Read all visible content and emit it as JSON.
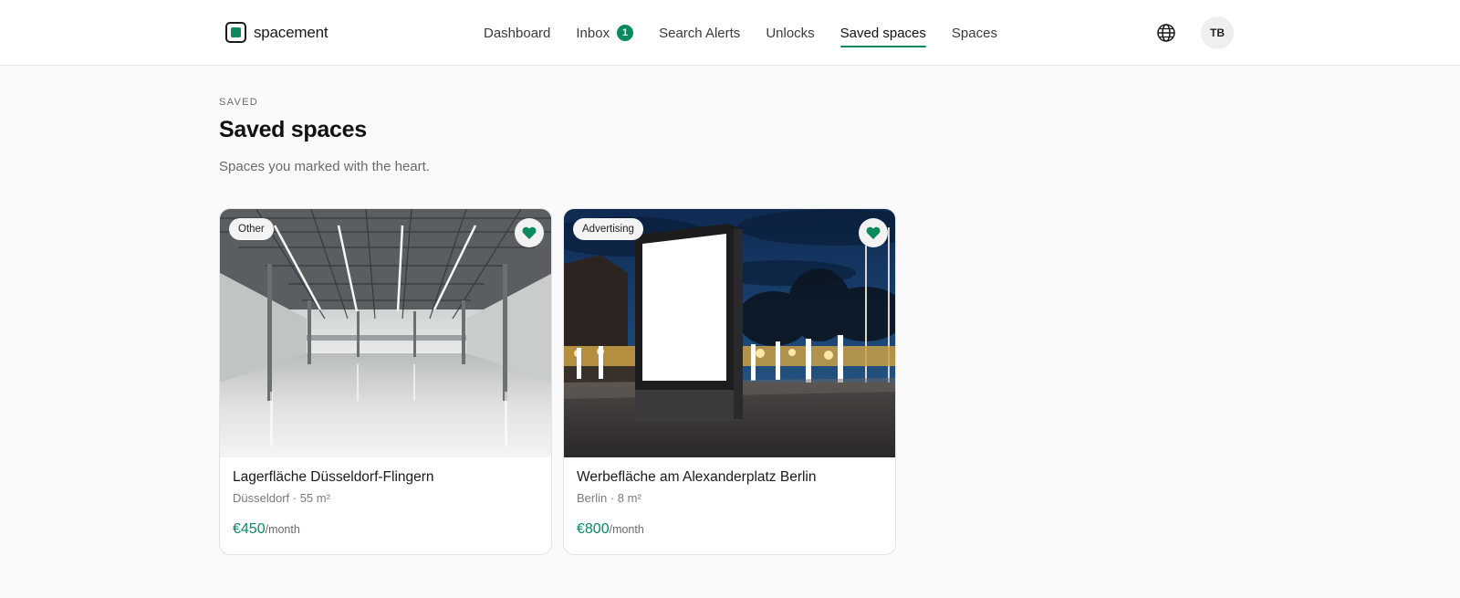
{
  "brand": {
    "name": "spacement",
    "accent": "#0b8a5e"
  },
  "nav": {
    "items": [
      {
        "label": "Dashboard"
      },
      {
        "label": "Inbox",
        "badge": "1"
      },
      {
        "label": "Search Alerts"
      },
      {
        "label": "Unlocks"
      },
      {
        "label": "Saved spaces",
        "active": true
      },
      {
        "label": "Spaces"
      }
    ],
    "globe_icon": "globe-icon",
    "avatar_initials": "TB"
  },
  "page": {
    "eyebrow": "SAVED",
    "title": "Saved spaces",
    "subtitle": "Spaces you marked with the heart."
  },
  "cards": [
    {
      "tag": "Other",
      "title": "Lagerfläche Düsseldorf-Flingern",
      "meta": "Düsseldorf · 55 m²",
      "price": "€450",
      "price_unit": "/month",
      "saved": true
    },
    {
      "tag": "Advertising",
      "title": "Werbefläche am Alexanderplatz Berlin",
      "meta": "Berlin · 8 m²",
      "price": "€800",
      "price_unit": "/month",
      "saved": true
    }
  ]
}
